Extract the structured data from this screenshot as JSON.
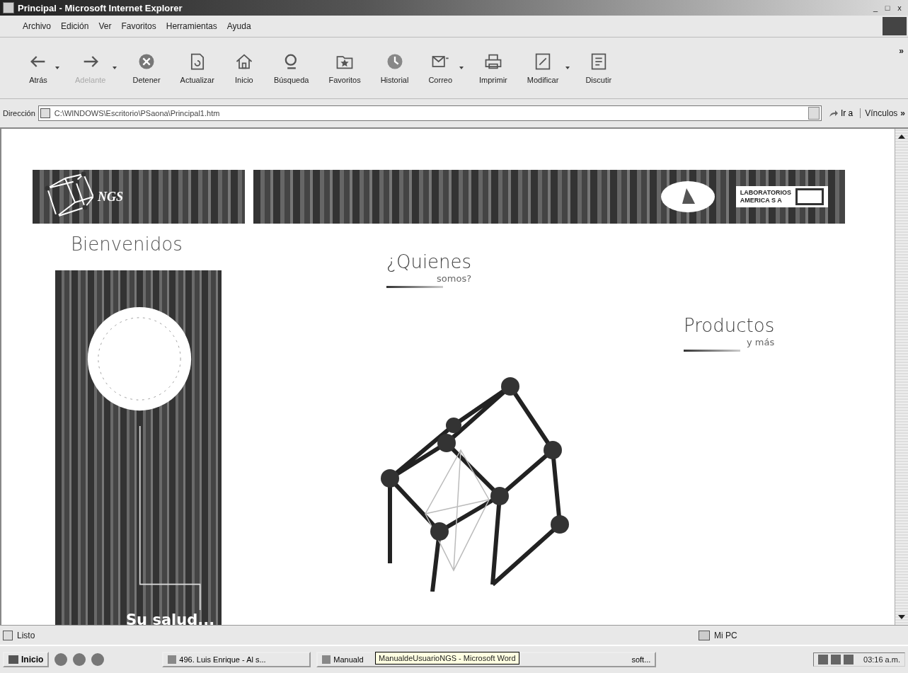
{
  "window": {
    "title": "Principal - Microsoft Internet Explorer",
    "controls": [
      "_",
      "□",
      "x"
    ]
  },
  "menu": [
    "Archivo",
    "Edición",
    "Ver",
    "Favoritos",
    "Herramientas",
    "Ayuda"
  ],
  "toolbar": [
    {
      "label": "Atrás",
      "disabled": false,
      "dropdown": true
    },
    {
      "label": "Adelante",
      "disabled": true,
      "dropdown": true
    },
    {
      "label": "Detener",
      "disabled": false,
      "dropdown": false
    },
    {
      "label": "Actualizar",
      "disabled": false,
      "dropdown": false
    },
    {
      "label": "Inicio",
      "disabled": false,
      "dropdown": false
    },
    {
      "label": "Búsqueda",
      "disabled": false,
      "dropdown": false
    },
    {
      "label": "Favoritos",
      "disabled": false,
      "dropdown": false
    },
    {
      "label": "Historial",
      "disabled": false,
      "dropdown": false
    },
    {
      "label": "Correo",
      "disabled": false,
      "dropdown": true
    },
    {
      "label": "Imprimir",
      "disabled": false,
      "dropdown": false
    },
    {
      "label": "Modificar",
      "disabled": false,
      "dropdown": true
    },
    {
      "label": "Discutir",
      "disabled": false,
      "dropdown": false
    }
  ],
  "toolbar_more": "»",
  "address": {
    "label": "Dirección",
    "value": "C:\\WINDOWS\\Escritorio\\PSaona\\Principal1.htm",
    "go": "Ir a",
    "links": "Vínculos",
    "links_more": "»"
  },
  "page": {
    "logo": {
      "name": "NGS"
    },
    "partner": {
      "line_1": "LABORATORIOS",
      "line_2": "AMERICA S A"
    },
    "welcome": "Bienvenidos",
    "panel_text": "Su salud...",
    "links": [
      {
        "title": "¿Quienes",
        "subtitle": "somos?"
      },
      {
        "title": "Productos",
        "subtitle": "y más"
      }
    ]
  },
  "status_bar": {
    "text": "Listo",
    "zone": "Mi PC"
  },
  "taskbar": {
    "start": "Inicio",
    "tasks": [
      {
        "label": "496. Luis Enrique - Al s..."
      },
      {
        "label": "Manuald",
        "tail": "soft..."
      }
    ],
    "tooltip": "ManualdeUsuarioNGS - Microsoft Word",
    "clock": "03:16 a.m."
  }
}
